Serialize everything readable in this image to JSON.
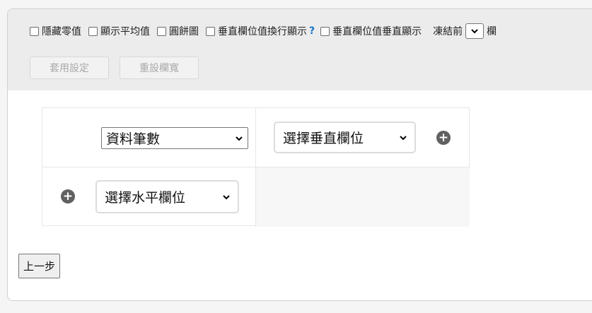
{
  "toolbar": {
    "options": [
      {
        "label": "隱藏零值",
        "checked": false
      },
      {
        "label": "顯示平均值",
        "checked": false
      },
      {
        "label": "圓餅圖",
        "checked": false
      },
      {
        "label": "垂直欄位值換行顯示",
        "checked": false
      },
      {
        "label": "垂直欄位值垂直顯示",
        "checked": false
      }
    ],
    "help": "?",
    "freeze_prefix": "凍結前",
    "freeze_suffix": "欄",
    "apply_label": "套用設定",
    "reset_label": "重設欄寬"
  },
  "pivot": {
    "value_field": "資料筆數",
    "vertical_placeholder": "選擇垂直欄位",
    "horizontal_placeholder": "選擇水平欄位",
    "add_symbol": "+"
  },
  "back_label": "上一步"
}
